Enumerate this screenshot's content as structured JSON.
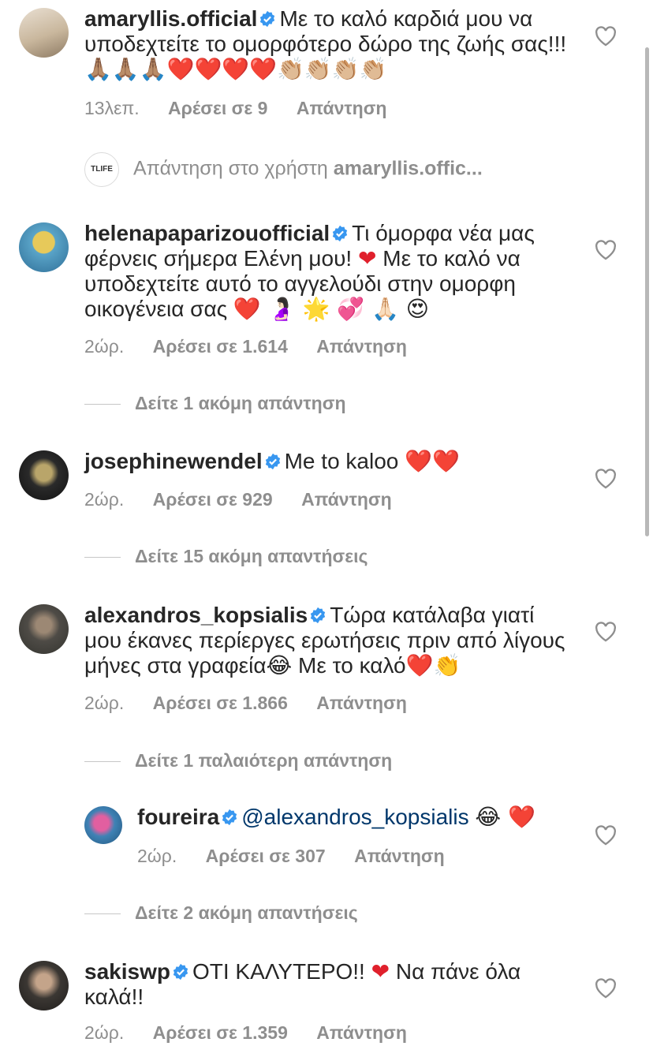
{
  "comments": [
    {
      "username": "amaryllis.official",
      "text": "Με το καλό καρδιά μου να υποδεχτείτε το ομορφότερο δώρο της ζωής σας!!!",
      "emojis": "🙏🏽🙏🏽🙏🏽❤️❤️❤️❤️👏🏼👏🏼👏🏼👏🏼",
      "time": "13λεπ.",
      "likes": "Αρέσει σε 9",
      "reply": "Απάντηση"
    },
    {
      "username": "helenapaparizouofficial",
      "text_a": "Τι όμορφα νέα μας φέρνεις σήμερα Ελένη μου!",
      "text_b": "Με το καλό να υποδεχτείτε αυτό το αγγελούδι στην ομορφη οικογένεια σας",
      "emojis": "❤️ 🤰🏻 🌟 💞 🙏🏻 😍",
      "time": "2ώρ.",
      "likes": "Αρέσει σε 1.614",
      "reply": "Απάντηση"
    },
    {
      "username": "josephinewendel",
      "text": "Me to kaloo",
      "emojis": "❤️❤️",
      "time": "2ώρ.",
      "likes": "Αρέσει σε 929",
      "reply": "Απάντηση"
    },
    {
      "username": "alexandros_kopsialis",
      "text": "Τώρα κατάλαβα γιατί μου έκανες περίεργες ερωτήσεις πριν από λίγους μήνες στα γραφεία😂 Με το καλό❤️👏",
      "time": "2ώρ.",
      "likes": "Αρέσει σε 1.866",
      "reply": "Απάντηση"
    },
    {
      "username": "foureira",
      "mention": "@alexandros_kopsialis",
      "emojis": "😂 ❤️",
      "time": "2ώρ.",
      "likes": "Αρέσει σε 307",
      "reply": "Απάντηση"
    },
    {
      "username": "sakiswp",
      "text_a": "ΟΤΙ ΚΑΛΥΤΕΡΟ!!",
      "text_b": "Να πάνε όλα καλά!!",
      "time": "2ώρ.",
      "likes": "Αρέσει σε 1.359",
      "reply": "Απάντηση"
    }
  ],
  "reply_to": {
    "prefix": "Απάντηση στο χρήστη",
    "username": "amaryllis.offic...",
    "avatar_text": "TLIFE"
  },
  "view_more": [
    "Δείτε 1 ακόμη απάντηση",
    "Δείτε 15 ακόμη απαντήσεις",
    "Δείτε 1 παλαιότερη απάντηση",
    "Δείτε 2 ακόμη απαντήσεις"
  ],
  "colors": {
    "text": "#262626",
    "meta": "#8e8e8e",
    "verified": "#3897f0",
    "heart": "#e0202c",
    "mention": "#00376b"
  }
}
